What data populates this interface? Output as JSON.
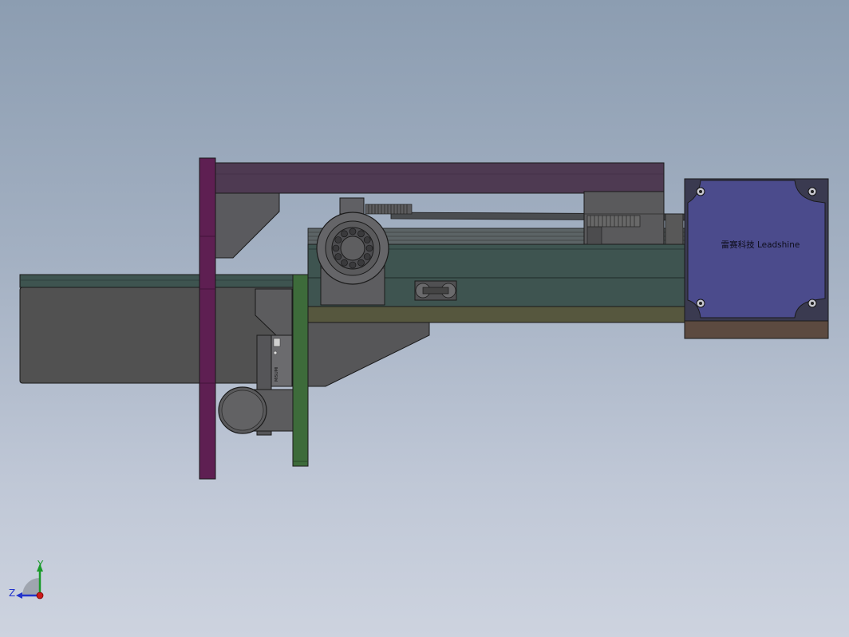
{
  "motor": {
    "brand_text": "雷赛科技 Leadshine"
  },
  "carriage_marking": "MISUMI",
  "triad": {
    "y_label": "Y",
    "z_label": "Z"
  },
  "colors": {
    "background_top": "#8c9db1",
    "background_bottom": "#cdd3df",
    "motor_face": "#4b4b8c",
    "frame_bar": "#4e3a52",
    "purple_upright": "#5e1f52",
    "green_bracket": "#3d6b3a",
    "rail_body": "#3e5450",
    "base_plate": "#56573e",
    "gray_housing": "#505050",
    "motor_base": "#5c4a40"
  }
}
